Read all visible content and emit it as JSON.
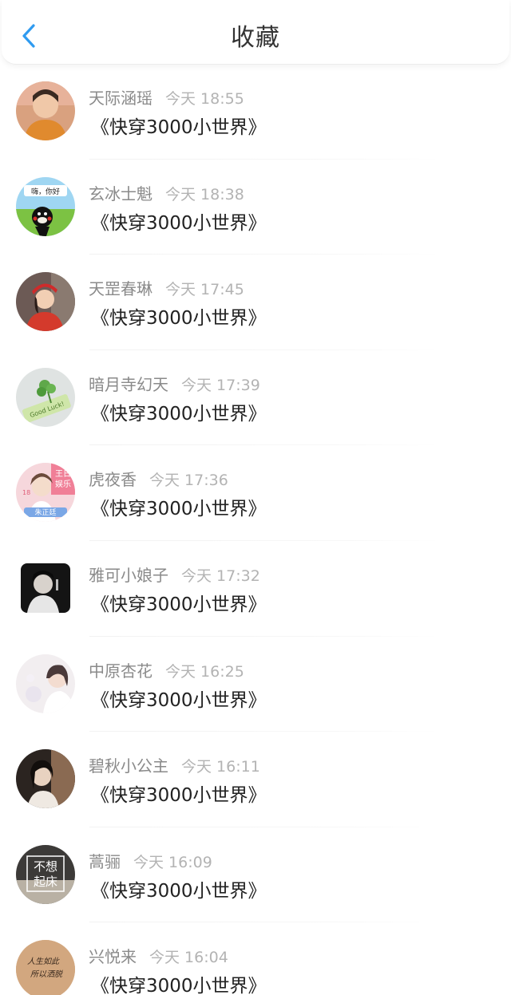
{
  "header": {
    "title": "收藏",
    "back_icon": "back-chevron-icon"
  },
  "colors": {
    "accent": "#2f9bf0",
    "name": "#8a8a8a",
    "time": "#b3b3b3",
    "book": "#222222"
  },
  "favorites": [
    {
      "user": "天际涵瑶",
      "time": "今天 18:55",
      "book": "《快穿3000小世界》"
    },
    {
      "user": "玄冰士魁",
      "time": "今天 18:38",
      "book": "《快穿3000小世界》"
    },
    {
      "user": "天罡春琳",
      "time": "今天 17:45",
      "book": "《快穿3000小世界》"
    },
    {
      "user": "暗月寺幻天",
      "time": "今天 17:39",
      "book": "《快穿3000小世界》"
    },
    {
      "user": "虎夜香",
      "time": "今天 17:36",
      "book": "《快穿3000小世界》"
    },
    {
      "user": "雅可小娘子",
      "time": "今天 17:32",
      "book": "《快穿3000小世界》"
    },
    {
      "user": "中原杏花",
      "time": "今天 16:25",
      "book": "《快穿3000小世界》"
    },
    {
      "user": "碧秋小公主",
      "time": "今天 16:11",
      "book": "《快穿3000小世界》"
    },
    {
      "user": "蒿骊",
      "time": "今天 16:09",
      "book": "《快穿3000小世界》"
    },
    {
      "user": "兴悦来",
      "time": "今天 16:04",
      "book": "《快穿3000小世界》"
    }
  ],
  "avatar_texts": {
    "kumamon": "嗨，你好",
    "goodluck": "Good Luck!",
    "poster_top": "王日",
    "poster_sub": "娱乐",
    "poster_name": "朱正廷",
    "poster_num": "18",
    "sign_line1": "不想",
    "sign_line2": "起床",
    "note_line1": "人生如此",
    "note_line2": "所以洒脱"
  }
}
